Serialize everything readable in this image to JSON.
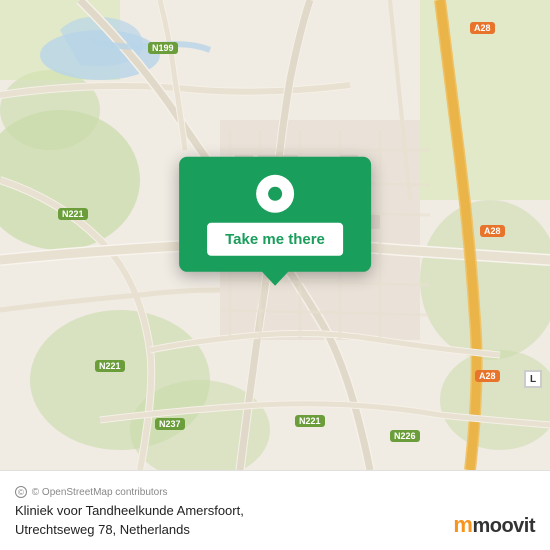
{
  "map": {
    "attribution": "© OpenStreetMap contributors",
    "center_lat": 52.155,
    "center_lon": 5.387
  },
  "popup": {
    "button_label": "Take me there",
    "pin_icon": "location-pin"
  },
  "place": {
    "name": "Kliniek voor Tandheelkunde Amersfoort,",
    "address": "Utrechtseweg 78, Netherlands"
  },
  "road_labels": [
    {
      "id": "n199-top",
      "text": "N199",
      "style": "green"
    },
    {
      "id": "n221-left",
      "text": "N221",
      "style": "green"
    },
    {
      "id": "n221-bottom-left",
      "text": "N221",
      "style": "green"
    },
    {
      "id": "n221-bottom",
      "text": "N221",
      "style": "green"
    },
    {
      "id": "n237",
      "text": "N237",
      "style": "green"
    },
    {
      "id": "n226",
      "text": "N226",
      "style": "green"
    },
    {
      "id": "a28-top",
      "text": "A28",
      "style": "orange"
    },
    {
      "id": "a28-mid",
      "text": "A28",
      "style": "orange"
    },
    {
      "id": "a28-bottom",
      "text": "A28",
      "style": "orange"
    }
  ],
  "moovit": {
    "logo_text": "moovit"
  },
  "l_marker": "L"
}
